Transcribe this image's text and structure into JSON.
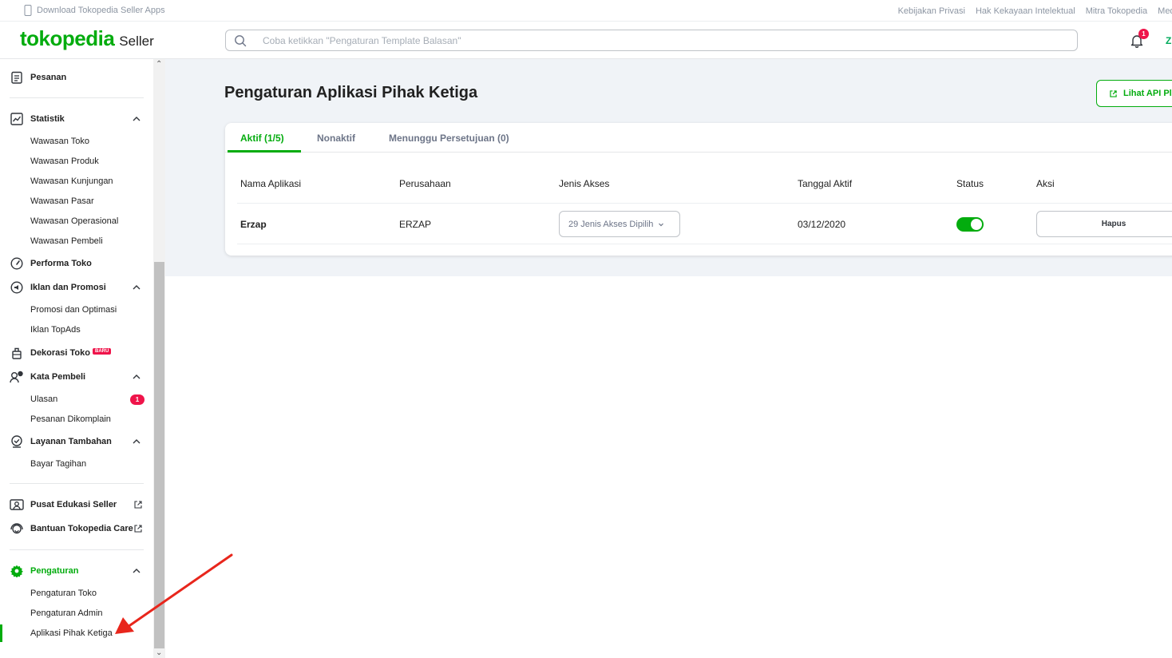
{
  "topbar": {
    "download_label": "Download Tokopedia Seller Apps",
    "links": [
      "Kebijakan Privasi",
      "Hak Kekayaan Intelektual",
      "Mitra Tokopedia",
      "Medi"
    ]
  },
  "header": {
    "brand": "tokopedia",
    "brand_suffix": "Seller",
    "search_placeholder": "Coba ketikkan \"Pengaturan Template Balasan\"",
    "notification_count": "1",
    "avatar_initial": "Z"
  },
  "sidebar": {
    "pesanan": "Pesanan",
    "statistik": "Statistik",
    "statistik_items": [
      "Wawasan Toko",
      "Wawasan Produk",
      "Wawasan Kunjungan",
      "Wawasan Pasar",
      "Wawasan Operasional",
      "Wawasan Pembeli"
    ],
    "performa": "Performa Toko",
    "iklan": "Iklan dan Promosi",
    "iklan_items": [
      "Promosi dan Optimasi",
      "Iklan TopAds"
    ],
    "dekorasi": "Dekorasi Toko",
    "dekorasi_badge": "BARU",
    "kata_pembeli": "Kata Pembeli",
    "kata_items": [
      "Ulasan",
      "Pesanan Dikomplain"
    ],
    "ulasan_count": "1",
    "layanan": "Layanan Tambahan",
    "layanan_items": [
      "Bayar Tagihan"
    ],
    "edukasi": "Pusat Edukasi Seller",
    "bantuan": "Bantuan Tokopedia Care",
    "pengaturan": "Pengaturan",
    "pengaturan_items": [
      "Pengaturan Toko",
      "Pengaturan Admin",
      "Aplikasi Pihak Ketiga"
    ]
  },
  "main": {
    "title": "Pengaturan Aplikasi Pihak Ketiga",
    "api_button": "Lihat API Pla",
    "tabs": [
      "Aktif (1/5)",
      "Nonaktif",
      "Menunggu Persetujuan (0)"
    ],
    "columns": [
      "Nama Aplikasi",
      "Perusahaan",
      "Jenis Akses",
      "Tanggal Aktif",
      "Status",
      "Aksi"
    ],
    "rows": [
      {
        "app": "Erzap",
        "company": "ERZAP",
        "access": "29 Jenis Akses Dipilih",
        "date": "03/12/2020",
        "status_on": true,
        "action": "Hapus"
      }
    ]
  },
  "colors": {
    "accent": "#03ac0e",
    "badge": "#ef144a",
    "annotation_arrow": "#e8261c"
  }
}
